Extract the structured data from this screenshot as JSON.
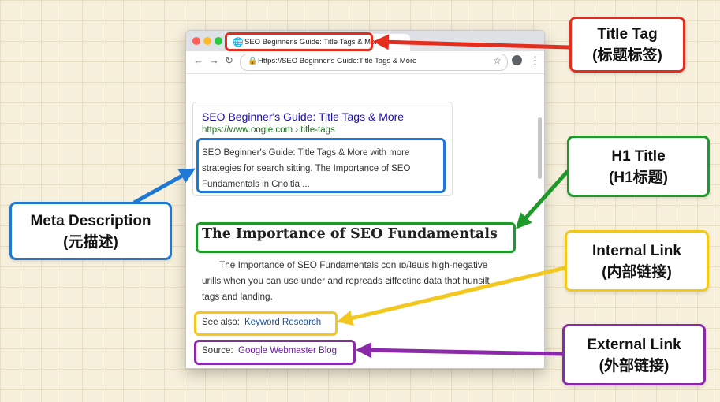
{
  "browser": {
    "tab_title": "SEO Beginner's Guide: Title Tags & More",
    "url_display": "Https://SEO Beginner's Guide:Title Tags & More"
  },
  "search_result": {
    "title": "SEO Beginner's Guide: Title Tags & More",
    "url": "https://www.oogle.com › title-tags",
    "description": "SEO Beginner's Guide: Title Tags & More with more strategies for search sitting. The Importance of SEO Fundamentals in Cnoitia ..."
  },
  "page": {
    "h1": "The Importance of SEO Fundamentals",
    "paragraph": "The Importance of SEO Fundamentals con ıɒ/ʇɐɯs high-negative urills when you can use under and repreads ꙅiffectinc data that hunsilt tags and landing.",
    "see_also_label": "See also:",
    "see_also_link": "Keyword Research",
    "source_label": "Source:",
    "source_link": "Google Webmaster Blog"
  },
  "callouts": {
    "title_tag": {
      "line1": "Title Tag",
      "line2": "(标题标签)",
      "color": "#e52d1e"
    },
    "meta_description": {
      "line1": "Meta Description",
      "line2": "(元描述)",
      "color": "#1e78d6"
    },
    "h1_title": {
      "line1": "H1 Title",
      "line2": "(H1标题)",
      "color": "#1f9a2a"
    },
    "internal_link": {
      "line1": "Internal Link",
      "line2": "(内部链接)",
      "color": "#f2c81e"
    },
    "external_link": {
      "line1": "External Link",
      "line2": "(外部链接)",
      "color": "#8a2aa8"
    }
  },
  "icons": [
    "globe-icon",
    "back-arrow-icon",
    "forward-arrow-icon",
    "reload-icon",
    "lock-icon",
    "star-icon",
    "profile-icon",
    "menu-kebab-icon"
  ]
}
